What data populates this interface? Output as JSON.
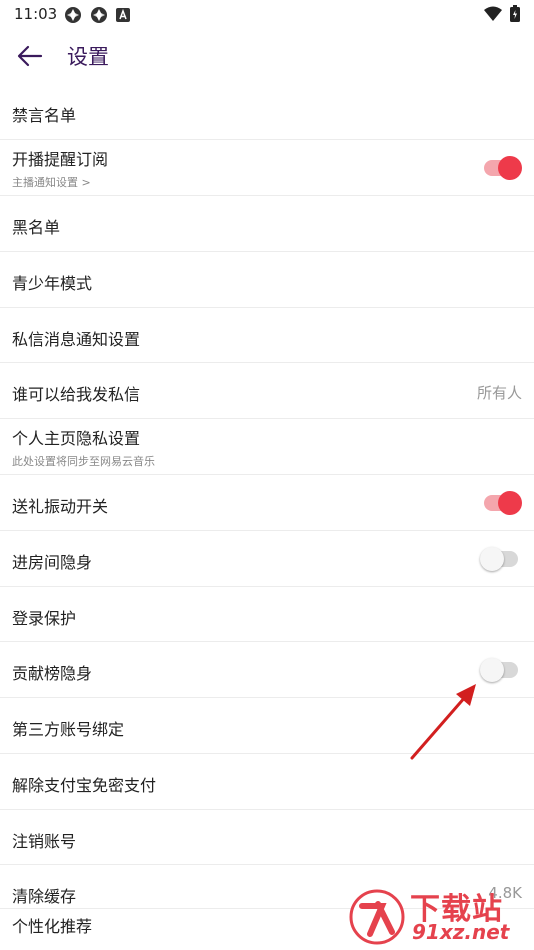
{
  "status_bar": {
    "time": "11:03"
  },
  "header": {
    "title": "设置"
  },
  "settings": [
    {
      "label": "禁言名单"
    },
    {
      "label": "开播提醒订阅",
      "sub": "主播通知设置 >",
      "toggle": true
    },
    {
      "label": "黑名单"
    },
    {
      "label": "青少年模式"
    },
    {
      "label": "私信消息通知设置"
    },
    {
      "label": "谁可以给我发私信",
      "value": "所有人"
    },
    {
      "label": "个人主页隐私设置",
      "sub": "此处设置将同步至网易云音乐"
    },
    {
      "label": "送礼振动开关",
      "toggle": true
    },
    {
      "label": "进房间隐身",
      "toggle": false
    },
    {
      "label": "登录保护"
    },
    {
      "label": "贡献榜隐身",
      "toggle": false
    },
    {
      "label": "第三方账号绑定"
    },
    {
      "label": "解除支付宝免密支付"
    },
    {
      "label": "注销账号"
    },
    {
      "label": "清除缓存",
      "value": "4.8K"
    },
    {
      "label": "个性化推荐"
    }
  ],
  "watermark": {
    "title": "下载站",
    "domain": "91xz.net"
  },
  "colors": {
    "accent": "#ee3a4a",
    "title": "#3a1a5c",
    "toggle_on_track": "#f4a6ad",
    "toggle_off_track": "#d8d8d8"
  }
}
